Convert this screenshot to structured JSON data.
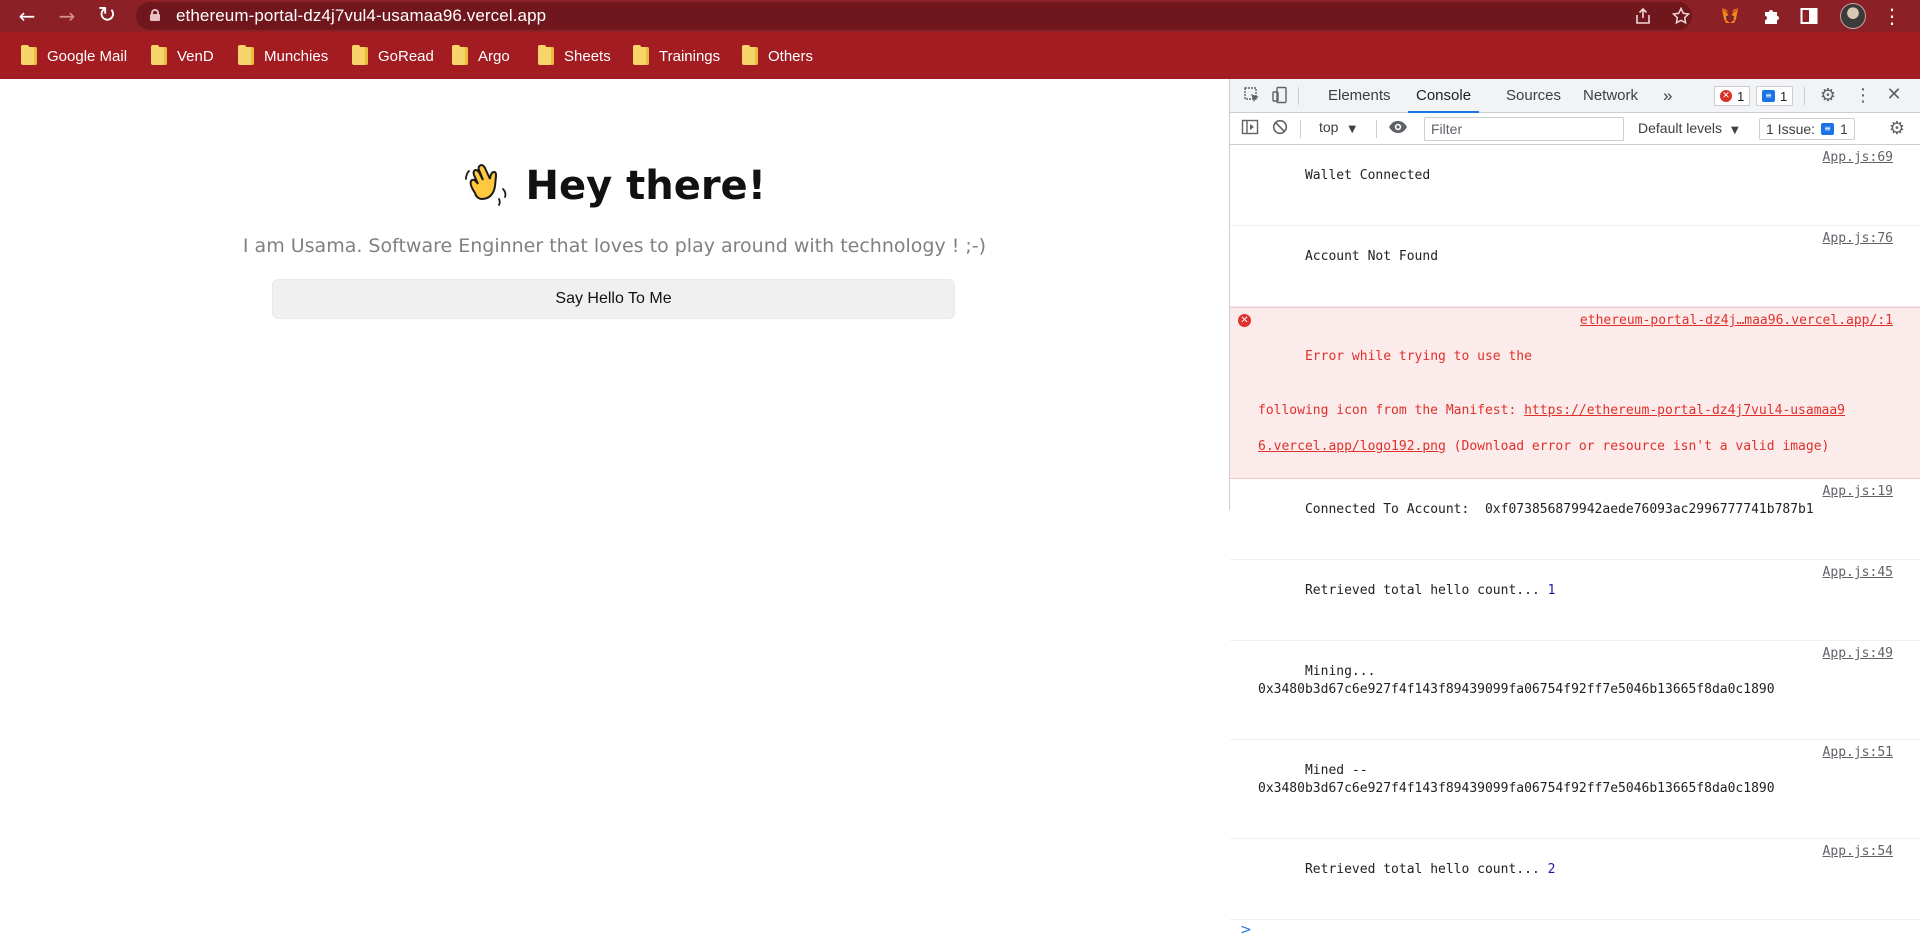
{
  "browser": {
    "url": "ethereum-portal-dz4j7vul4-usamaa96.vercel.app",
    "nav": {
      "back": "←",
      "forward": "→",
      "reload": "↻"
    },
    "icons": [
      "share-icon",
      "star-icon",
      "metamask-fox-icon",
      "extensions-puzzle-icon",
      "side-panel-icon",
      "profile-avatar",
      "menu-kebab-icon"
    ]
  },
  "bookmarks": [
    {
      "label": "Google Mail"
    },
    {
      "label": "VenD"
    },
    {
      "label": "Munchies"
    },
    {
      "label": "GoRead"
    },
    {
      "label": "Argo"
    },
    {
      "label": "Sheets"
    },
    {
      "label": "Trainings"
    },
    {
      "label": "Others"
    }
  ],
  "page": {
    "emoji": "👋",
    "title": "Hey there!",
    "subtitle": "I am Usama. Software Enginner that loves to play around with technology ! ;-)",
    "button_label": "Say Hello To Me"
  },
  "devtools": {
    "tabs": [
      "Elements",
      "Console",
      "Sources",
      "Network"
    ],
    "active_tab": "Console",
    "more_tabs": "»",
    "error_count": "1",
    "message_count": "1",
    "context": "top",
    "filter_placeholder": "Filter",
    "levels": "Default levels",
    "issues_label": "1 Issue:",
    "issues_count": "1",
    "messages": [
      {
        "text": "Wallet Connected",
        "source": "App.js:69"
      },
      {
        "text": "Account Not Found",
        "source": "App.js:76"
      },
      {
        "type": "error",
        "line1": "Error while trying to use the",
        "source": "ethereum-portal-dz4j…maa96.vercel.app/:1",
        "line2_prefix": "following icon from the Manifest: ",
        "link_a": "https://ethereum-portal-dz4j7vul4-usamaa9",
        "link_b": "6.vercel.app/logo192.png",
        "line3_suffix": " (Download error or resource isn't a valid image)"
      },
      {
        "text": "Connected To Account:  0xf073856879942aede76093ac2996777741b787b1",
        "source": "App.js:19"
      },
      {
        "text": "Retrieved total hello count... ",
        "num": "1",
        "source": "App.js:45"
      },
      {
        "text": "Mining...\n0x3480b3d67c6e927f4f143f89439099fa06754f92ff7e5046b13665f8da0c1890",
        "source": "App.js:49"
      },
      {
        "text": "Mined --\n0x3480b3d67c6e927f4f143f89439099fa06754f92ff7e5046b13665f8da0c1890",
        "source": "App.js:51"
      },
      {
        "text": "Retrieved total hello count... ",
        "num": "2",
        "source": "App.js:54"
      }
    ],
    "prompt": ">"
  }
}
